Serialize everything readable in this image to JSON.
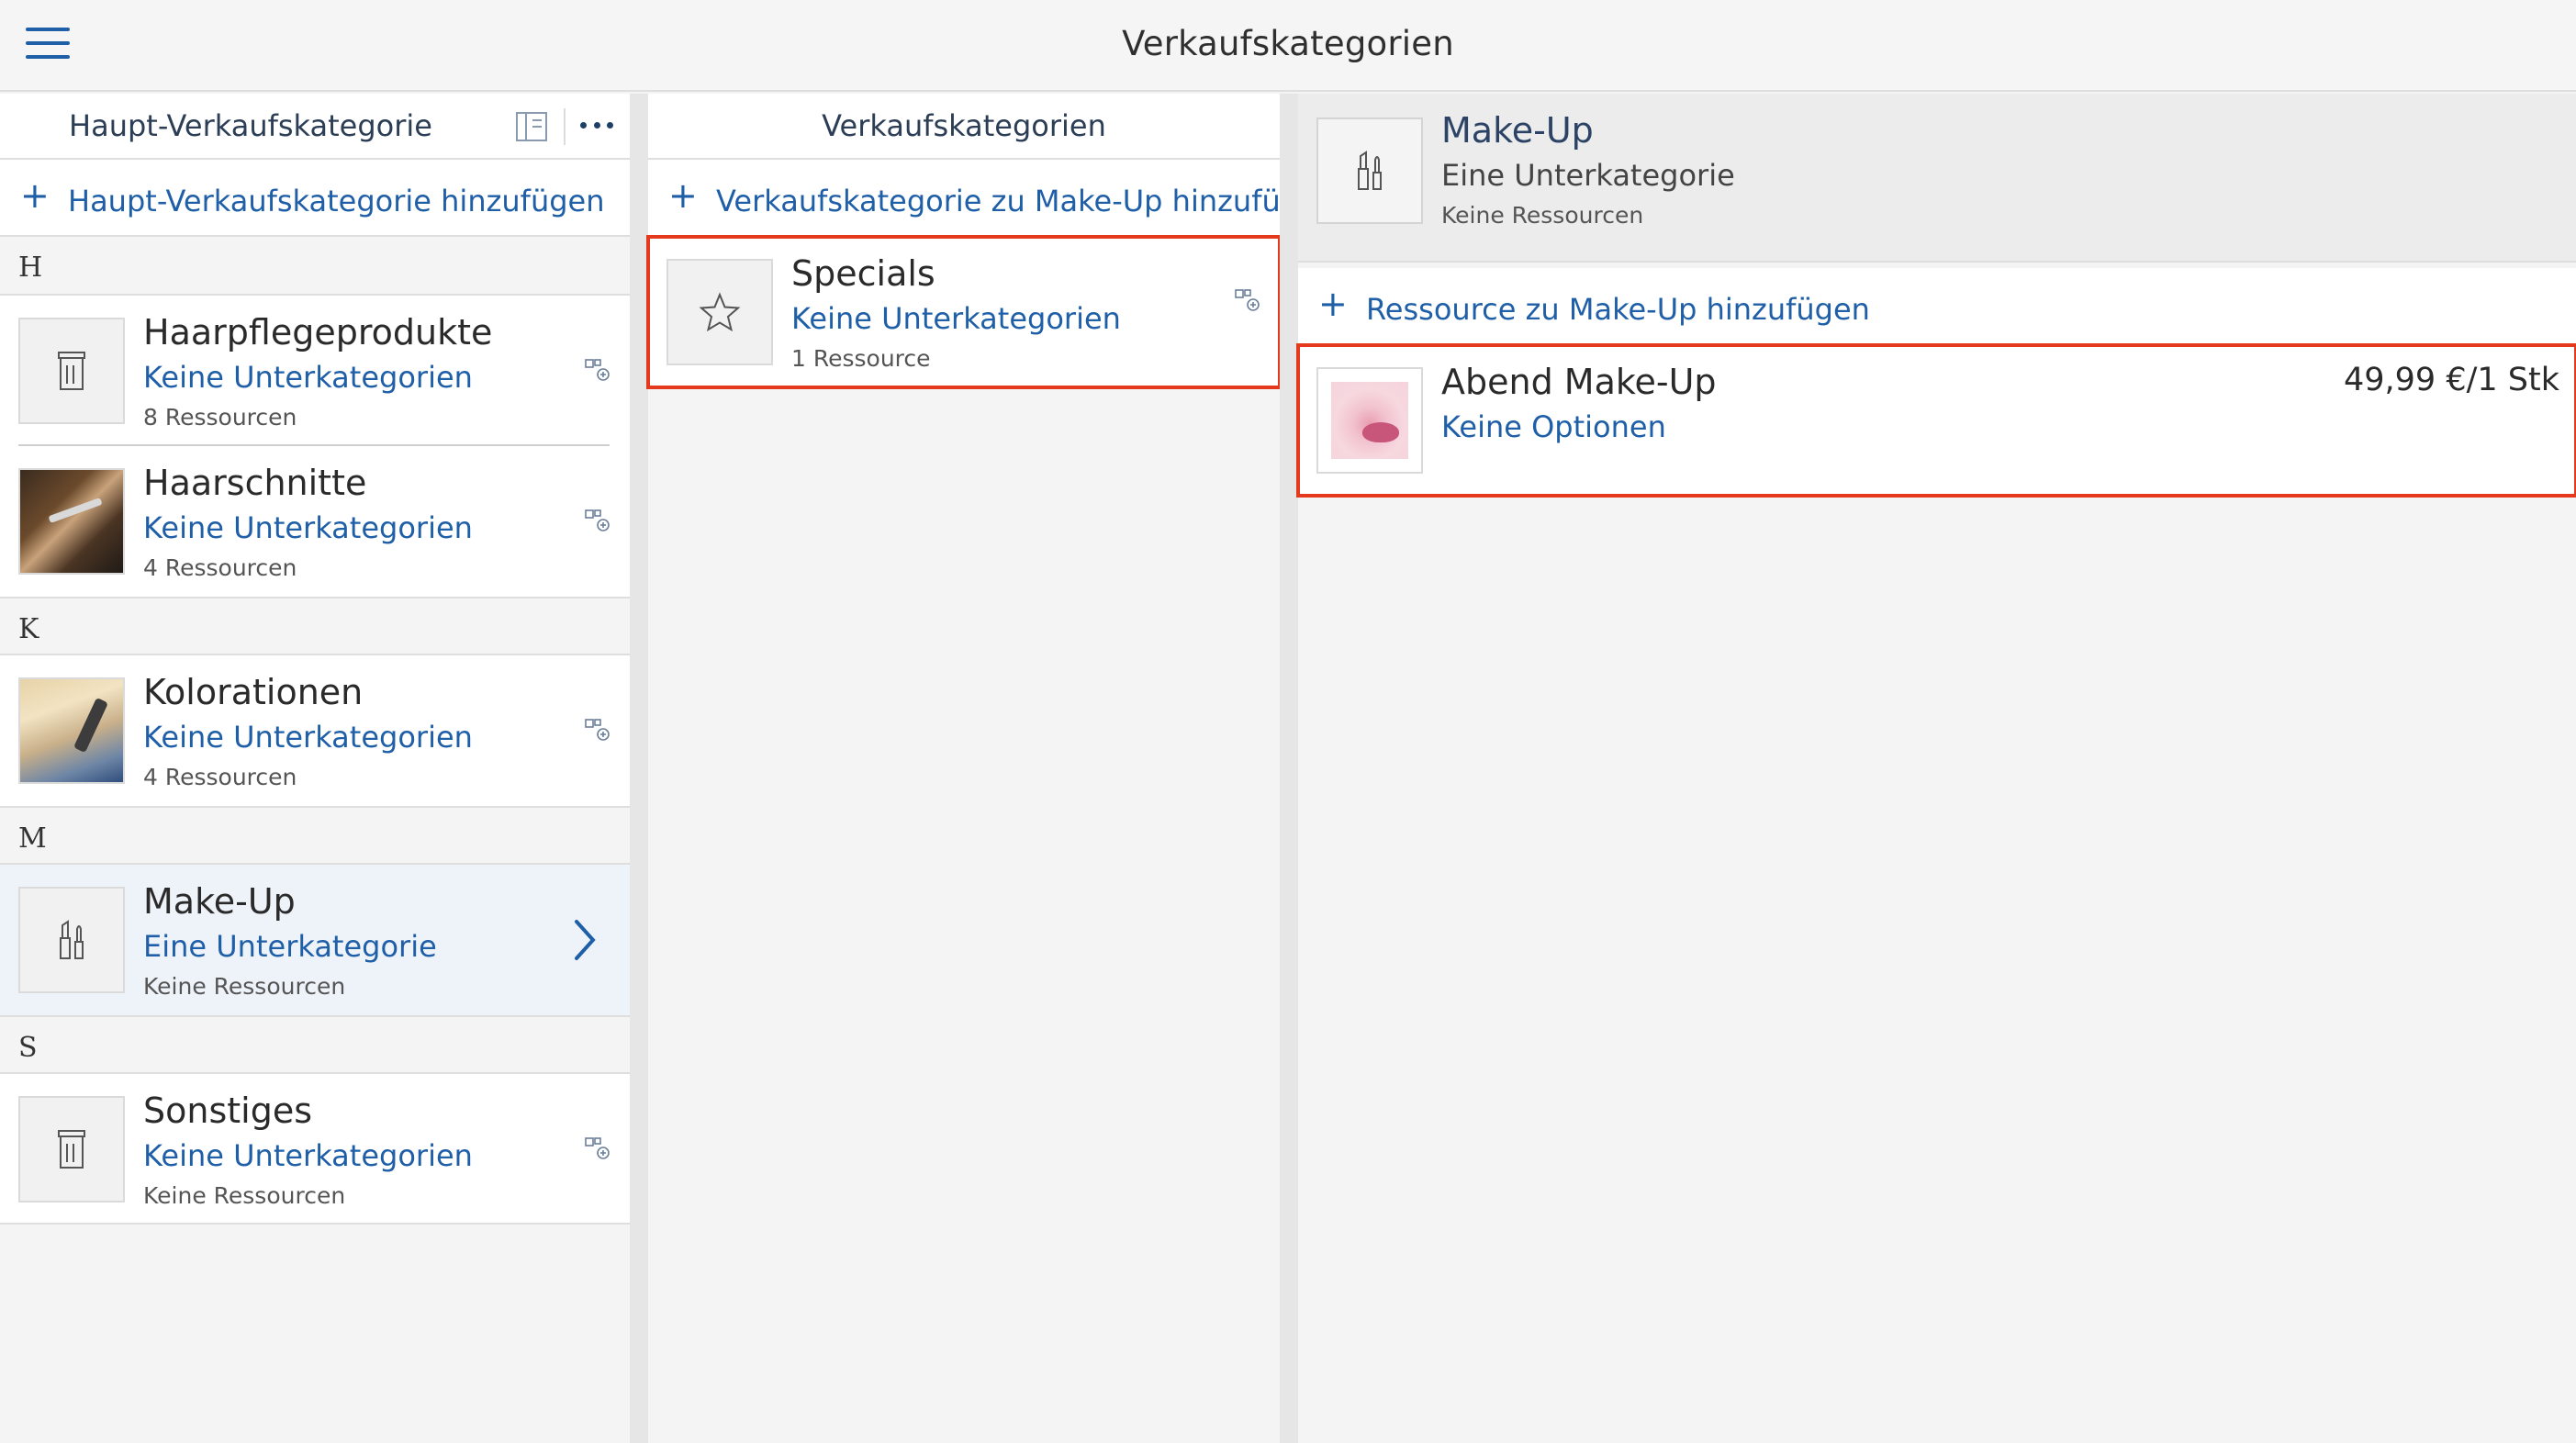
{
  "app": {
    "title": "Verkaufskategorien"
  },
  "column1": {
    "header": "Haupt-Verkaufskategorie",
    "add_label": "Haupt-Verkaufskategorie hinzufügen",
    "sections": [
      {
        "letter": "H",
        "items": [
          {
            "title": "Haarpflegeprodukte",
            "sub": "Keine Unterkategorien",
            "meta": "8 Ressourcen"
          },
          {
            "title": "Haarschnitte",
            "sub": "Keine Unterkategorien",
            "meta": "4 Ressourcen"
          }
        ]
      },
      {
        "letter": "K",
        "items": [
          {
            "title": "Kolorationen",
            "sub": "Keine Unterkategorien",
            "meta": "4 Ressourcen"
          }
        ]
      },
      {
        "letter": "M",
        "items": [
          {
            "title": "Make-Up",
            "sub": "Eine Unterkategorie",
            "meta": "Keine Ressourcen"
          }
        ]
      },
      {
        "letter": "S",
        "items": [
          {
            "title": "Sonstiges",
            "sub": "Keine Unterkategorien",
            "meta": "Keine Ressourcen"
          }
        ]
      }
    ]
  },
  "column2": {
    "header": "Verkaufskategorien",
    "add_label": "Verkaufskategorie zu Make-Up hinzufügen",
    "items": [
      {
        "title": "Specials",
        "sub": "Keine Unterkategorien",
        "meta": "1 Ressource"
      }
    ]
  },
  "column3": {
    "detail": {
      "title": "Make-Up",
      "sub": "Eine Unterkategorie",
      "meta": "Keine Ressourcen"
    },
    "add_label": "Ressource zu Make-Up hinzufügen",
    "resources": [
      {
        "title": "Abend Make-Up",
        "sub": "Keine Optionen",
        "price": "49,99 €/1 Stk"
      }
    ]
  },
  "colors": {
    "accent": "#1f5fa8",
    "highlight": "#e5391d",
    "selected_bg": "#eef3fa"
  }
}
